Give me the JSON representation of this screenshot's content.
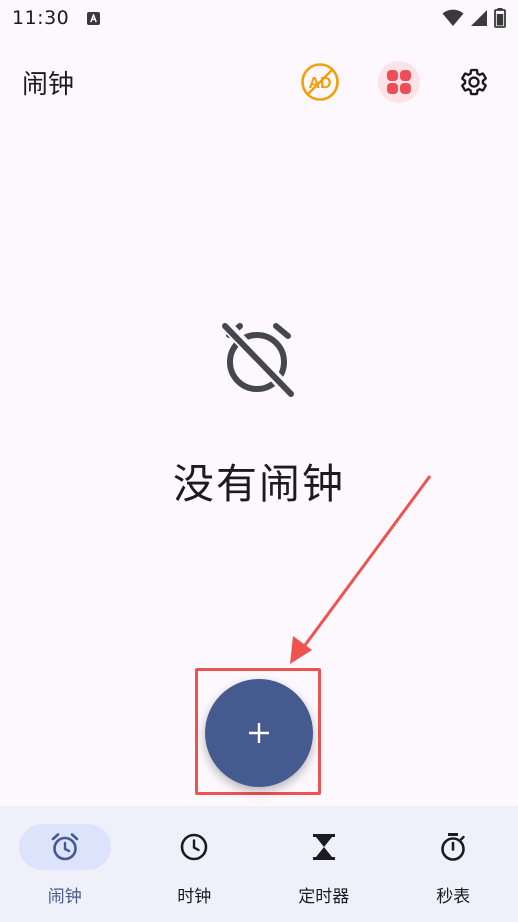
{
  "status_bar": {
    "time": "11:30",
    "notification_icon": "a-letter-icon",
    "right_icons": [
      "wifi-icon",
      "signal-icon",
      "battery-icon"
    ]
  },
  "app_bar": {
    "title": "闹钟",
    "actions": [
      {
        "name": "remove-ads-icon",
        "label": "AD",
        "color": "#f59e0b"
      },
      {
        "name": "apps-grid-icon",
        "color": "#ef4d5b"
      },
      {
        "name": "gear-icon"
      }
    ]
  },
  "empty_state": {
    "icon": "alarm-off-icon",
    "message": "没有闹钟"
  },
  "fab": {
    "icon": "plus-icon",
    "color": "#455a8e",
    "highlight_color": "#ef5350"
  },
  "bottom_nav": {
    "items": [
      {
        "label": "闹钟",
        "icon": "alarm-icon",
        "active": true
      },
      {
        "label": "时钟",
        "icon": "clock-icon",
        "active": false
      },
      {
        "label": "定时器",
        "icon": "hourglass-icon",
        "active": false
      },
      {
        "label": "秒表",
        "icon": "stopwatch-icon",
        "active": false
      }
    ]
  }
}
